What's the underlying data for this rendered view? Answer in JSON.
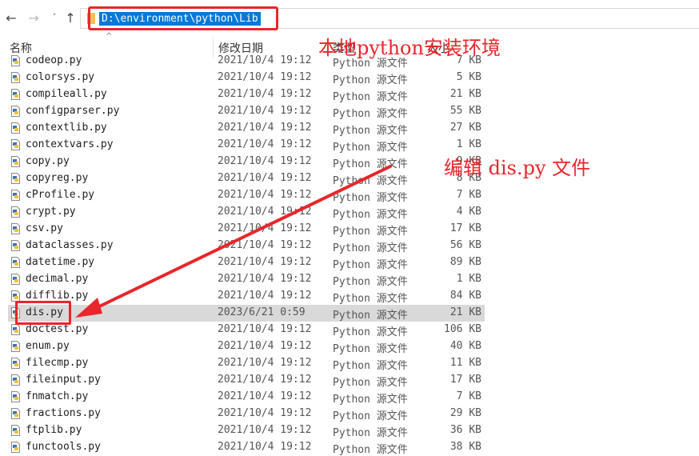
{
  "nav": {
    "back_icon": "←",
    "forward_icon": "→",
    "recent_icon": "˅",
    "up_icon": "↑"
  },
  "address": {
    "path": "D:\\environment\\python\\Lib"
  },
  "columns": {
    "name": "名称",
    "date": "修改日期",
    "type": "类型",
    "size": "大小"
  },
  "annotations": {
    "local_env": "本地python安装环境",
    "edit_file": "编辑 dis.py 文件"
  },
  "files": [
    {
      "name": "codeop.py",
      "date": "2021/10/4 19:12",
      "type": "Python 源文件",
      "size": "7 KB"
    },
    {
      "name": "colorsys.py",
      "date": "2021/10/4 19:12",
      "type": "Python 源文件",
      "size": "5 KB"
    },
    {
      "name": "compileall.py",
      "date": "2021/10/4 19:12",
      "type": "Python 源文件",
      "size": "21 KB"
    },
    {
      "name": "configparser.py",
      "date": "2021/10/4 19:12",
      "type": "Python 源文件",
      "size": "55 KB"
    },
    {
      "name": "contextlib.py",
      "date": "2021/10/4 19:12",
      "type": "Python 源文件",
      "size": "27 KB"
    },
    {
      "name": "contextvars.py",
      "date": "2021/10/4 19:12",
      "type": "Python 源文件",
      "size": "1 KB"
    },
    {
      "name": "copy.py",
      "date": "2021/10/4 19:12",
      "type": "Python 源文件",
      "size": "9 KB"
    },
    {
      "name": "copyreg.py",
      "date": "2021/10/4 19:12",
      "type": "Python 源文件",
      "size": "8 KB"
    },
    {
      "name": "cProfile.py",
      "date": "2021/10/4 19:12",
      "type": "Python 源文件",
      "size": "7 KB"
    },
    {
      "name": "crypt.py",
      "date": "2021/10/4 19:12",
      "type": "Python 源文件",
      "size": "4 KB"
    },
    {
      "name": "csv.py",
      "date": "2021/10/4 19:12",
      "type": "Python 源文件",
      "size": "17 KB"
    },
    {
      "name": "dataclasses.py",
      "date": "2021/10/4 19:12",
      "type": "Python 源文件",
      "size": "56 KB"
    },
    {
      "name": "datetime.py",
      "date": "2021/10/4 19:12",
      "type": "Python 源文件",
      "size": "89 KB"
    },
    {
      "name": "decimal.py",
      "date": "2021/10/4 19:12",
      "type": "Python 源文件",
      "size": "1 KB"
    },
    {
      "name": "difflib.py",
      "date": "2021/10/4 19:12",
      "type": "Python 源文件",
      "size": "84 KB"
    },
    {
      "name": "dis.py",
      "date": "2023/6/21 0:59",
      "type": "Python 源文件",
      "size": "21 KB",
      "selected": true
    },
    {
      "name": "doctest.py",
      "date": "2021/10/4 19:12",
      "type": "Python 源文件",
      "size": "106 KB"
    },
    {
      "name": "enum.py",
      "date": "2021/10/4 19:12",
      "type": "Python 源文件",
      "size": "40 KB"
    },
    {
      "name": "filecmp.py",
      "date": "2021/10/4 19:12",
      "type": "Python 源文件",
      "size": "11 KB"
    },
    {
      "name": "fileinput.py",
      "date": "2021/10/4 19:12",
      "type": "Python 源文件",
      "size": "17 KB"
    },
    {
      "name": "fnmatch.py",
      "date": "2021/10/4 19:12",
      "type": "Python 源文件",
      "size": "7 KB"
    },
    {
      "name": "fractions.py",
      "date": "2021/10/4 19:12",
      "type": "Python 源文件",
      "size": "29 KB"
    },
    {
      "name": "ftplib.py",
      "date": "2021/10/4 19:12",
      "type": "Python 源文件",
      "size": "36 KB"
    },
    {
      "name": "functools.py",
      "date": "2021/10/4 19:12",
      "type": "Python 源文件",
      "size": "38 KB"
    }
  ],
  "colors": {
    "annotation_red": "#e8262b",
    "selection_blue": "#0078d7",
    "row_selected": "#d9d9d9",
    "py_icon_blue": "#3a76b7"
  }
}
